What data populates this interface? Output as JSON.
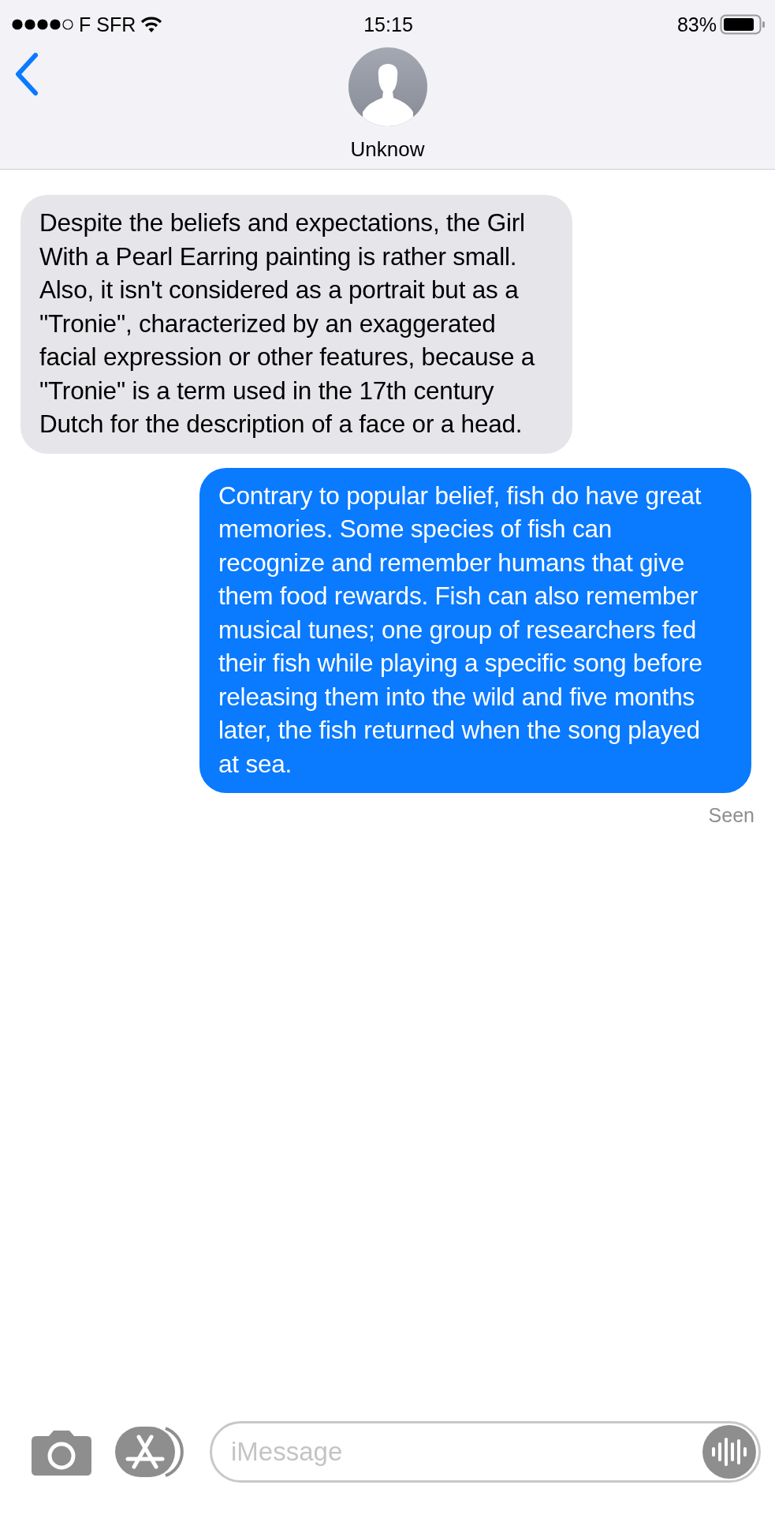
{
  "status_bar": {
    "carrier": "F SFR",
    "time": "15:15",
    "battery": "83%"
  },
  "contact": {
    "name": "Unknow"
  },
  "messages": [
    {
      "kind": "incoming",
      "text": "Despite the beliefs and expectations, the Girl With a Pearl Earring painting is rather small. Also, it isn't considered as a portrait but as a \"Tronie\", characterized by an exaggerated facial expression or other features, because a \"Tronie\" is a term used in the 17th century Dutch for the description of a face or a head."
    },
    {
      "kind": "outgoing",
      "text": "Contrary to popular belief, fish do have great memories. Some species of fish can recognize and remember humans that give them food rewards. Fish can also remember musical tunes; one group of researchers fed their fish while playing a specific song before releasing them into the wild and five months later, the fish returned when the song played at sea."
    }
  ],
  "receipt": "Seen",
  "composer": {
    "placeholder": "iMessage"
  }
}
